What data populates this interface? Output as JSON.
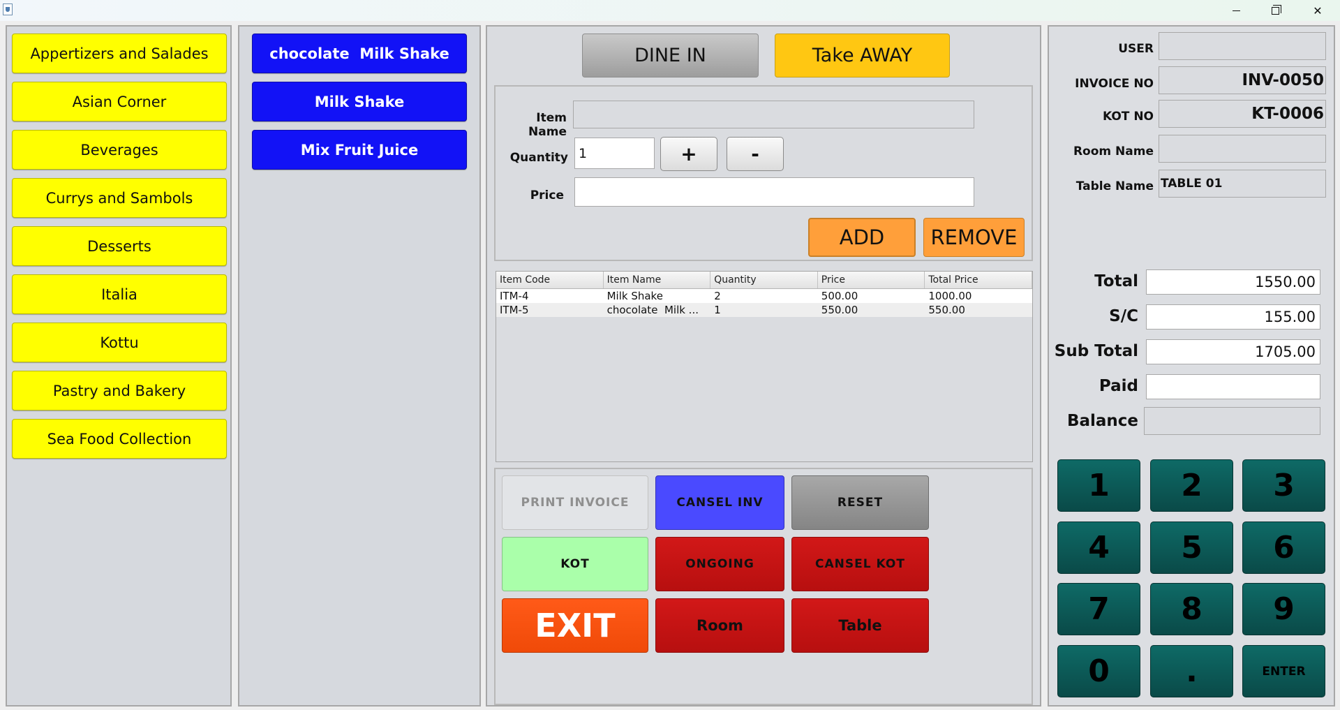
{
  "window": {
    "minimize_glyph": "",
    "close_glyph": "✕"
  },
  "categories": [
    "Appertizers and Salades",
    "Asian Corner",
    "Beverages",
    "Currys and Sambols",
    "Desserts",
    "Italia",
    "Kottu",
    "Pastry and Bakery",
    "Sea Food Collection"
  ],
  "items": [
    "chocolate  Milk Shake",
    "Milk Shake",
    "Mix Fruit Juice"
  ],
  "order": {
    "dine_in_label": "DINE IN",
    "take_away_label": "Take AWAY",
    "item_name_label": "Item Name",
    "item_name_value": "",
    "quantity_label": "Quantity",
    "quantity_value": "1",
    "plus_label": "+",
    "minus_label": "-",
    "price_label": "Price",
    "price_value": "",
    "add_label": "ADD",
    "remove_label": "REMOVE"
  },
  "table": {
    "columns": [
      "Item Code",
      "Item Name",
      "Quantity",
      "Price",
      "Total Price"
    ],
    "rows": [
      [
        "ITM-4",
        "Milk Shake",
        "2",
        "500.00",
        "1000.00"
      ],
      [
        "ITM-5",
        "chocolate  Milk ...",
        "1",
        "550.00",
        "550.00"
      ]
    ]
  },
  "actions": {
    "print_invoice": "PRINT INVOICE",
    "cancel_inv": "CANSEL  INV",
    "reset": "RESET",
    "kot": "KOT",
    "ongoing": "ONGOING",
    "cancel_kot": "CANSEL KOT",
    "exit": "EXIT",
    "room": "Room",
    "table": "Table"
  },
  "billing": {
    "user_label": "USER",
    "user_value": "",
    "invoice_no_label": "INVOICE NO",
    "invoice_no_value": "INV-0050",
    "kot_no_label": "KOT NO",
    "kot_no_value": "KT-0006",
    "room_name_label": "Room Name",
    "room_name_value": "",
    "table_name_label": "Table Name",
    "table_name_value": "TABLE 01",
    "total_label": "Total",
    "total_value": "1550.00",
    "sc_label": "S/C",
    "sc_value": "155.00",
    "sub_total_label": "Sub Total",
    "sub_total_value": "1705.00",
    "paid_label": "Paid",
    "paid_value": "",
    "balance_label": "Balance",
    "balance_value": ""
  },
  "keypad": [
    "1",
    "2",
    "3",
    "4",
    "5",
    "6",
    "7",
    "8",
    "9",
    "0",
    ".",
    "ENTER"
  ],
  "colors": {
    "category_button": "#ffff00",
    "item_button": "#1212f6",
    "take_away": "#ffc712",
    "add_remove": "#ff9f3a",
    "cancel_inv": "#4a4aff",
    "kot": "#aaffaa",
    "danger_red": "#c41414",
    "exit": "#ff5511",
    "keypad": "#0b5755"
  }
}
